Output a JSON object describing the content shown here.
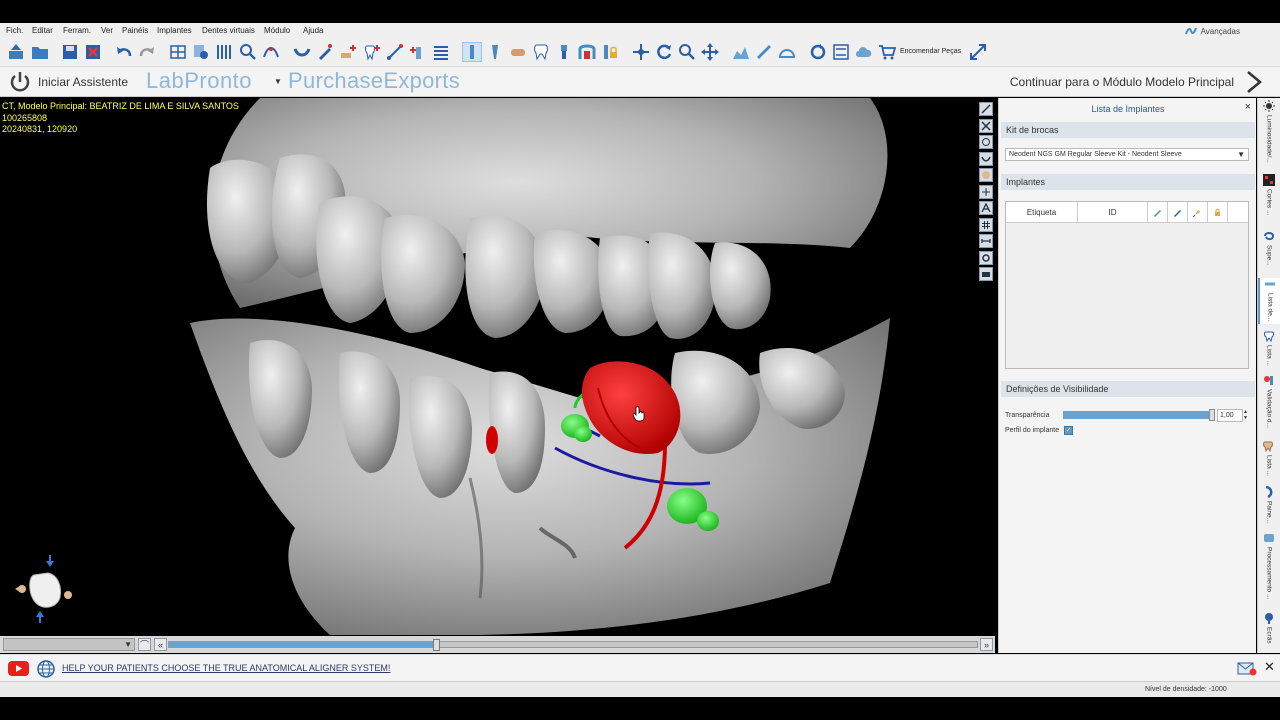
{
  "menu": {
    "items": [
      "Fich.",
      "Editar",
      "Ferram.",
      "Ver",
      "Painéis",
      "Implantes",
      "Dentes virtuais",
      "Módulo",
      "Ajuda"
    ],
    "advanced_label": "Avançadas"
  },
  "toolbar": {
    "order_label": "Encomendar Peças"
  },
  "assistant": {
    "start_label": "Iniciar Assistente",
    "brand_labpronto": "LabPronto",
    "brand_purchase": "PurchaseExports",
    "continue_label": "Continuar para o Módulo Modelo Principal"
  },
  "viewport": {
    "info_line1": "CT, Modelo Principal: BEATRIZ DE LIMA E SILVA SANTOS",
    "info_line2": "100265808",
    "info_line3": "20240831, 120920",
    "slice_position": 0.33
  },
  "panel": {
    "title": "Lista de Implantes",
    "close_label": "×",
    "kit_section": "Kit de brocas",
    "kit_value": "Neodent NGS GM Regular Sleeve Kit - Neodent Sleeve",
    "implants_section": "Implantes",
    "table_headers": [
      "Etiqueta",
      "ID"
    ],
    "visibility_section": "Definições de Visibilidade",
    "transparency_label": "Transparência",
    "transparency_value": "1,00",
    "transparency_level": 0.97,
    "profile_label": "Perfil do implante",
    "profile_checked": true
  },
  "side_tabs": [
    {
      "label": "Luminosidade/...",
      "icon": "sun-icon"
    },
    {
      "label": "Cortes ...",
      "icon": "slices-icon"
    },
    {
      "label": "Supe...",
      "icon": "surface-icon"
    },
    {
      "label": "Lista de...",
      "icon": "implant-list-icon"
    },
    {
      "label": "Lista ...",
      "icon": "tooth-list-icon"
    },
    {
      "label": "Validação d...",
      "icon": "validation-icon"
    },
    {
      "label": "Lista ...",
      "icon": "list-icon"
    },
    {
      "label": "Paine...",
      "icon": "panel-icon"
    },
    {
      "label": "Processamento ...",
      "icon": "processing-icon"
    },
    {
      "label": "Ecrãs",
      "icon": "screens-icon"
    }
  ],
  "news": {
    "link_text": "HELP YOUR PATIENTS CHOOSE THE TRUE ANATOMICAL ALIGNER SYSTEM!",
    "close_label": "✕"
  },
  "status": {
    "density_text": "Nível de densidade: -1000"
  },
  "colors": {
    "accent": "#5d9acb",
    "info_text": "#ffff66",
    "implant_red": "#e00000",
    "handle_green": "#33dd33",
    "axis_blue": "#1a1aa0"
  }
}
